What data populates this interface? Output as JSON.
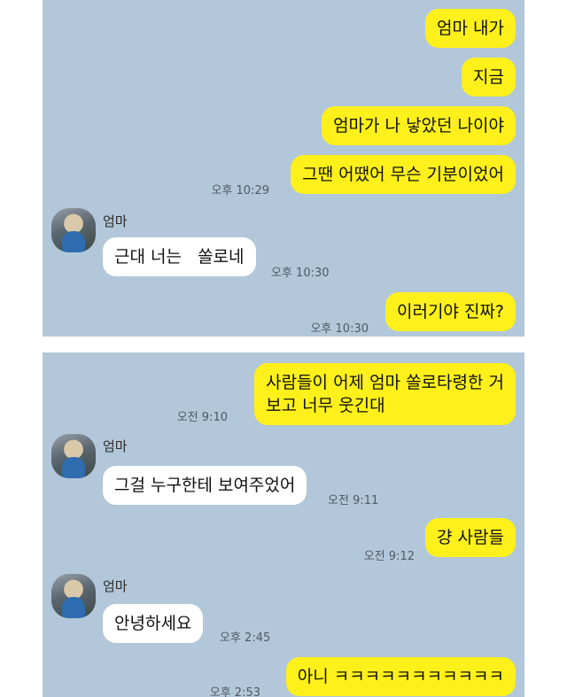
{
  "panel1": {
    "sender_name": "엄마",
    "messages": [
      {
        "text": "엄마 내가"
      },
      {
        "text": "지금"
      },
      {
        "text": "엄마가 나 낳았던 나이야"
      },
      {
        "text": "그땐 어땠어 무슨 기분이었어",
        "time": "오후 10:29"
      },
      {
        "text": "근대 너는   쏠로네",
        "time": "오후 10:30"
      },
      {
        "text": "이러기야 진짜?",
        "time": "오후 10:30"
      }
    ]
  },
  "panel2": {
    "messages": [
      {
        "line1": "사람들이 어제 엄마 쏠로타령한 거",
        "line2": "보고 너무 웃긴대",
        "time": "오전 9:10"
      },
      {
        "sender_name": "엄마",
        "text": "그걸 누구한테 보여주었어",
        "time": "오전 9:11"
      },
      {
        "text": "걍 사람들",
        "time": "오전 9:12"
      },
      {
        "sender_name": "엄마",
        "text": "안녕하세요",
        "time": "오후 2:45"
      },
      {
        "text": "아니 ㅋㅋㅋㅋㅋㅋㅋㅋㅋㅋㅋ",
        "time": "오후 2:53"
      }
    ]
  }
}
